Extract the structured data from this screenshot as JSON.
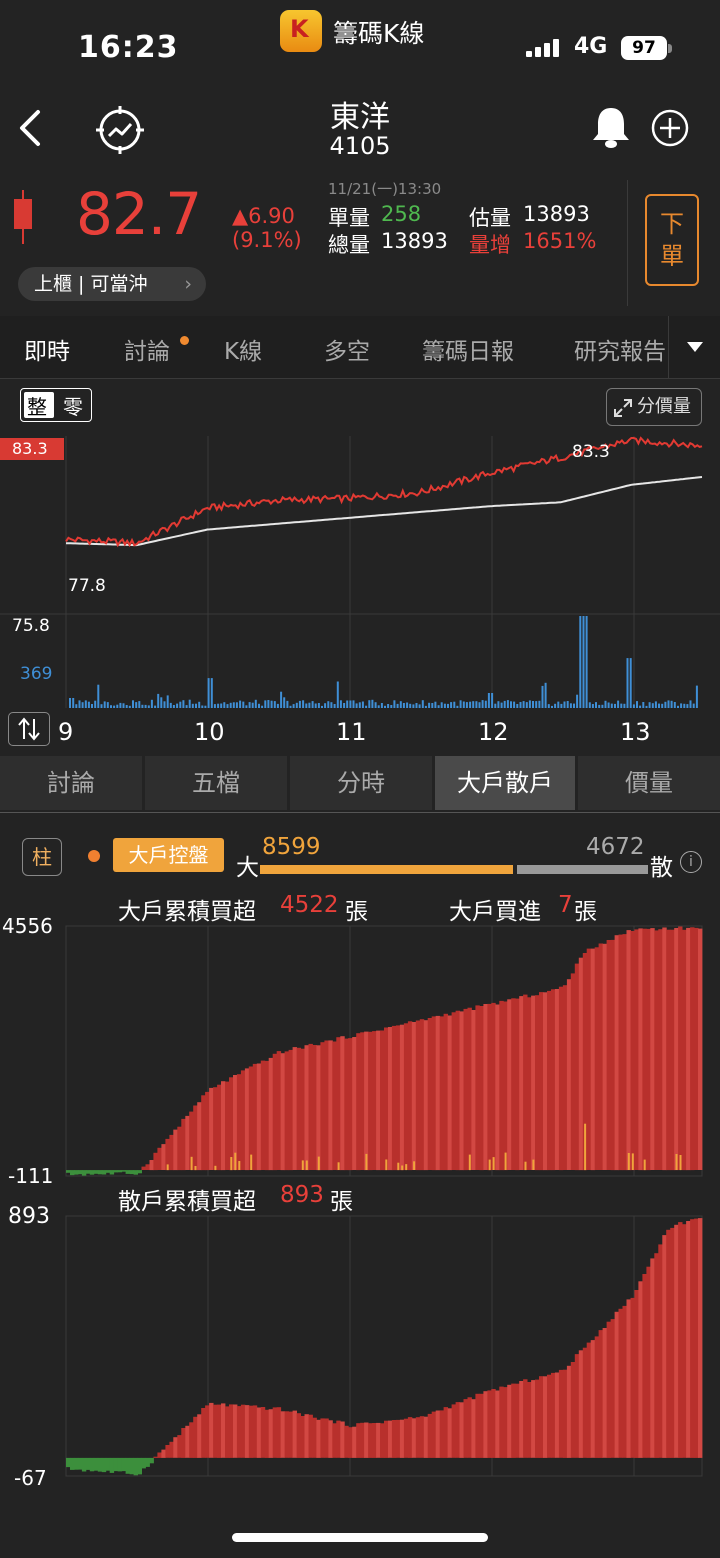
{
  "status_bar": {
    "time": "16:23",
    "app_name": "籌碼K線",
    "network": "4G",
    "battery": "97"
  },
  "header": {
    "stock_name": "東洋",
    "stock_code": "4105"
  },
  "quote": {
    "price": "82.7",
    "change": "▲6.90",
    "change_pct": "(9.1%)",
    "time": "11/21(一)13:30",
    "single_vol_label": "單量",
    "single_vol": "258",
    "est_vol_label": "估量",
    "est_vol": "13893",
    "total_vol_label": "總量",
    "total_vol": "13893",
    "vol_inc_label": "量增",
    "vol_inc": "1651%",
    "market_label": "上櫃 | 可當沖"
  },
  "order_button": {
    "line1": "下",
    "line2": "單"
  },
  "tabs": [
    "即時",
    "討論",
    "K線",
    "多空",
    "籌碼日報",
    "研究報告"
  ],
  "intraday": {
    "toggle_whole": "整",
    "toggle_odd": "零",
    "price_volume_button": "分價量",
    "price_max_tag": "83.3",
    "high_label": "83.3",
    "low_label": "77.8",
    "ref_label": "75.8",
    "vol_max_label": "369",
    "hour_labels": [
      "9",
      "10",
      "11",
      "12",
      "13"
    ]
  },
  "subtabs": [
    "討論",
    "五檔",
    "分時",
    "大戶散戶",
    "價量"
  ],
  "bigsmall": {
    "zhu_button": "柱",
    "control_badge": "大戶控盤",
    "big_label": "大",
    "big_value": "8599",
    "small_label": "散",
    "small_value": "4672",
    "big_cum_label": "大戶累積買超",
    "big_cum_value": "4522",
    "unit": "張",
    "big_buy_label": "大戶買進",
    "big_buy_value": "7",
    "big_axis_max": "4556",
    "big_axis_min": "-111",
    "small_cum_label": "散戶累積買超",
    "small_cum_value": "893",
    "small_axis_max": "893",
    "small_axis_min": "-67"
  },
  "colors": {
    "up": "#e8403a",
    "down": "#4fb84f",
    "accent": "#e8892e",
    "volume": "#3f8fd6"
  },
  "chart_data": [
    {
      "type": "line",
      "series": [],
      "x": [
        "09:00",
        "09:30",
        "10:00",
        "10:30",
        "11:00",
        "11:30",
        "12:00",
        "12:30",
        "13:00",
        "13:30"
      ],
      "price": [
        78.2,
        78.0,
        79.8,
        80.2,
        80.3,
        80.6,
        81.6,
        82.4,
        83.3,
        83.0
      ],
      "avg": [
        78.0,
        77.9,
        78.7,
        79.0,
        79.3,
        79.6,
        79.9,
        80.1,
        81.0,
        81.4
      ],
      "ylim": [
        75.8,
        83.3
      ]
    },
    {
      "type": "bar",
      "series": [],
      "x": [
        "09:00",
        "10:00",
        "11:00",
        "12:00",
        "12:40",
        "13:00",
        "13:30"
      ],
      "values": [
        40,
        120,
        30,
        60,
        369,
        200,
        90
      ],
      "ylim": [
        0,
        369
      ]
    },
    {
      "type": "area",
      "series": [],
      "x": [
        "09:00",
        "09:30",
        "10:00",
        "10:30",
        "11:00",
        "11:30",
        "12:00",
        "12:30",
        "12:40",
        "13:00",
        "13:30"
      ],
      "values": [
        -80,
        -60,
        1500,
        2200,
        2500,
        2800,
        3100,
        3400,
        4100,
        4500,
        4522
      ],
      "ylim": [
        -111,
        4556
      ]
    },
    {
      "type": "area",
      "series": [],
      "x": [
        "09:00",
        "09:30",
        "10:00",
        "10:30",
        "11:00",
        "11:30",
        "12:00",
        "12:30",
        "13:00",
        "13:15",
        "13:30"
      ],
      "values": [
        -40,
        -60,
        200,
        180,
        120,
        150,
        250,
        320,
        600,
        850,
        893
      ],
      "ylim": [
        -67,
        893
      ]
    }
  ]
}
